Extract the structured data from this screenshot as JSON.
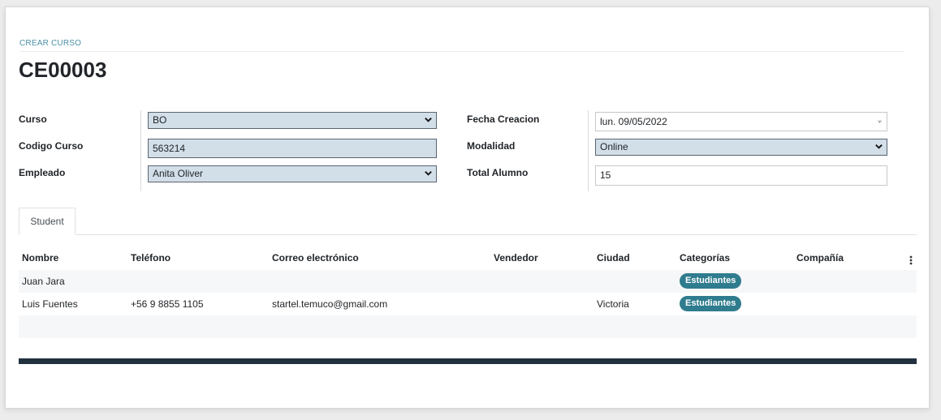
{
  "form": {
    "caption": "CREAR CURSO",
    "title": "CE00003",
    "fields": {
      "curso": {
        "label": "Curso",
        "value": "BO"
      },
      "codigo_curso": {
        "label": "Codigo Curso",
        "value": "563214"
      },
      "empleado": {
        "label": "Empleado",
        "value": "Anita Oliver"
      },
      "fecha_creacion": {
        "label": "Fecha Creacion",
        "value": "lun. 09/05/2022"
      },
      "modalidad": {
        "label": "Modalidad",
        "value": "Online"
      },
      "total_alumno": {
        "label": "Total Alumno",
        "value": "15"
      }
    }
  },
  "tabs": [
    {
      "label": "Student",
      "active": true
    }
  ],
  "table": {
    "columns": [
      "Nombre",
      "Teléfono",
      "Correo electrónico",
      "Vendedor",
      "Ciudad",
      "Categorías",
      "Compañía"
    ],
    "rows": [
      {
        "nombre": "Juan Jara",
        "telefono": "",
        "correo": "",
        "vendedor": "",
        "ciudad": "",
        "categoria": "Estudiantes",
        "compania": ""
      },
      {
        "nombre": "Luis Fuentes",
        "telefono": "+56 9 8855 1105",
        "correo": "startel.temuco@gmail.com",
        "vendedor": "",
        "ciudad": "Victoria",
        "categoria": "Estudiantes",
        "compania": ""
      }
    ]
  },
  "icons": {
    "select_arrow": "chevron-down-icon",
    "date_arrow": "caret-down-icon",
    "column_options": "vertical-dots-icon"
  },
  "colors": {
    "badge": "#2f7c8e",
    "editable_field": "#d2dfe9",
    "caption": "#4c8fa8",
    "footer_bar": "#22313f"
  }
}
